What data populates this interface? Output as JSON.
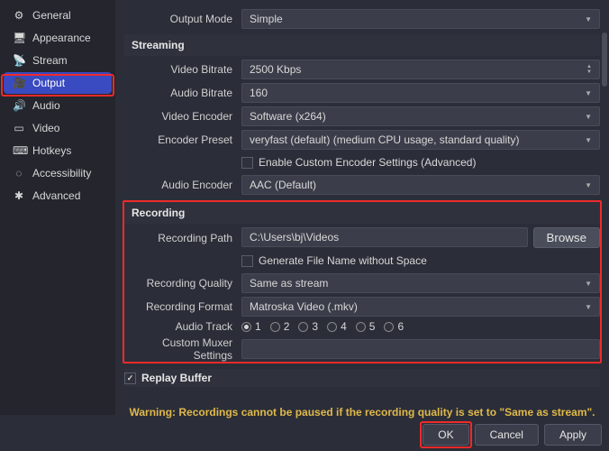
{
  "sidebar": {
    "items": [
      {
        "label": "General",
        "icon": "⚙"
      },
      {
        "label": "Appearance",
        "icon": "🖥"
      },
      {
        "label": "Stream",
        "icon": "📡"
      },
      {
        "label": "Output",
        "icon": "🎥"
      },
      {
        "label": "Audio",
        "icon": "🔊"
      },
      {
        "label": "Video",
        "icon": "▭"
      },
      {
        "label": "Hotkeys",
        "icon": "⌨"
      },
      {
        "label": "Accessibility",
        "icon": "◌"
      },
      {
        "label": "Advanced",
        "icon": "✱"
      }
    ]
  },
  "output_mode": {
    "label": "Output Mode",
    "value": "Simple"
  },
  "streaming": {
    "header": "Streaming",
    "video_bitrate": {
      "label": "Video Bitrate",
      "value": "2500 Kbps"
    },
    "audio_bitrate": {
      "label": "Audio Bitrate",
      "value": "160"
    },
    "video_encoder": {
      "label": "Video Encoder",
      "value": "Software (x264)"
    },
    "encoder_preset": {
      "label": "Encoder Preset",
      "value": "veryfast (default) (medium CPU usage, standard quality)"
    },
    "enable_custom": {
      "label": "Enable Custom Encoder Settings (Advanced)",
      "checked": false
    },
    "audio_encoder": {
      "label": "Audio Encoder",
      "value": "AAC (Default)"
    }
  },
  "recording": {
    "header": "Recording",
    "path": {
      "label": "Recording Path",
      "value": "C:\\Users\\bj\\Videos",
      "browse": "Browse"
    },
    "gen_filename": {
      "label": "Generate File Name without Space",
      "checked": false
    },
    "quality": {
      "label": "Recording Quality",
      "value": "Same as stream"
    },
    "format": {
      "label": "Recording Format",
      "value": "Matroska Video (.mkv)"
    },
    "audio_track": {
      "label": "Audio Track",
      "options": [
        "1",
        "2",
        "3",
        "4",
        "5",
        "6"
      ],
      "selected": "1"
    },
    "muxer": {
      "label": "Custom Muxer Settings",
      "value": ""
    }
  },
  "replay_buffer": {
    "label": "Replay Buffer",
    "checked": true
  },
  "warning": "Warning: Recordings cannot be paused if the recording quality is set to \"Same as stream\".",
  "footer": {
    "ok": "OK",
    "cancel": "Cancel",
    "apply": "Apply"
  }
}
